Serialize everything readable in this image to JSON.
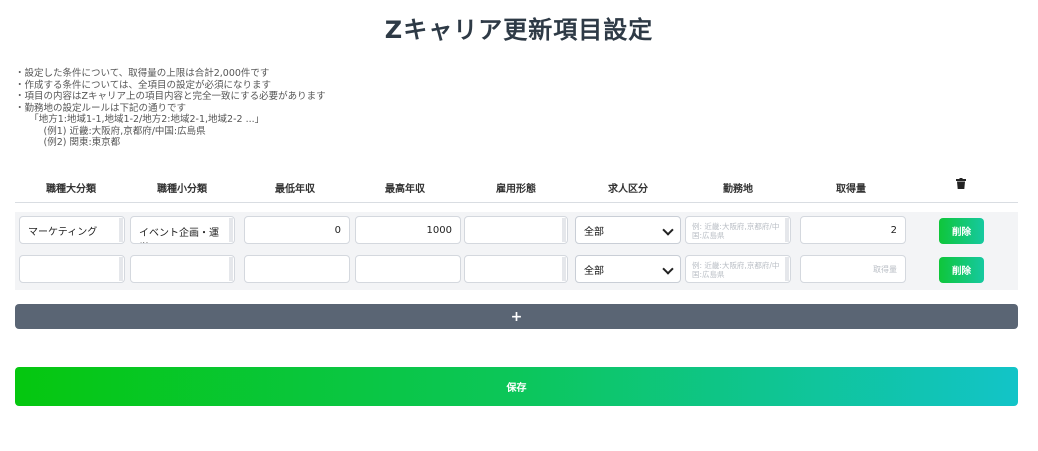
{
  "page": {
    "title": "Zキャリア更新項目設定"
  },
  "notes": [
    "・設定した条件について、取得量の上限は合計2,000件です",
    "・作成する条件については、全項目の設定が必須になります",
    "・項目の内容はZキャリア上の項目内容と完全一致にする必要があります",
    "・勤務地の設定ルールは下記の通りです",
    "　　「地方1:地域1-1,地域1-2/地方2:地域2-1,地域2-2 ...」",
    "　　　(例1) 近畿:大阪府,京都府/中国:広島県",
    "　　　(例2) 関東:東京都"
  ],
  "table": {
    "headers": [
      "職種大分類",
      "職種小分類",
      "最低年収",
      "最高年収",
      "雇用形態",
      "求人区分",
      "勤務地",
      "取得量"
    ],
    "delete_all_icon": "trash-icon",
    "rows": [
      {
        "category_large": "マーケティング",
        "category_small": "イベント企画・運営",
        "min_salary": "0",
        "max_salary": "1000",
        "employment_type": "",
        "job_type": "全部",
        "location": "",
        "location_placeholder": "例: 近畿:大阪府,京都府/中国:広島県",
        "quantity": "2",
        "quantity_placeholder": "取得量",
        "delete_label": "削除"
      },
      {
        "category_large": "",
        "category_small": "",
        "min_salary": "",
        "max_salary": "",
        "employment_type": "",
        "job_type": "全部",
        "location": "",
        "location_placeholder": "例: 近畿:大阪府,京都府/中国:広島県",
        "quantity": "",
        "quantity_placeholder": "取得量",
        "delete_label": "削除"
      }
    ]
  },
  "add_button": {
    "label": "+"
  },
  "save_button": {
    "label": "保存"
  },
  "colors": {
    "add_button": "#5a6574",
    "delete_button": "#0fc63a",
    "save_gradient_start": "#05c70f",
    "save_gradient_end": "#12c4c8"
  }
}
